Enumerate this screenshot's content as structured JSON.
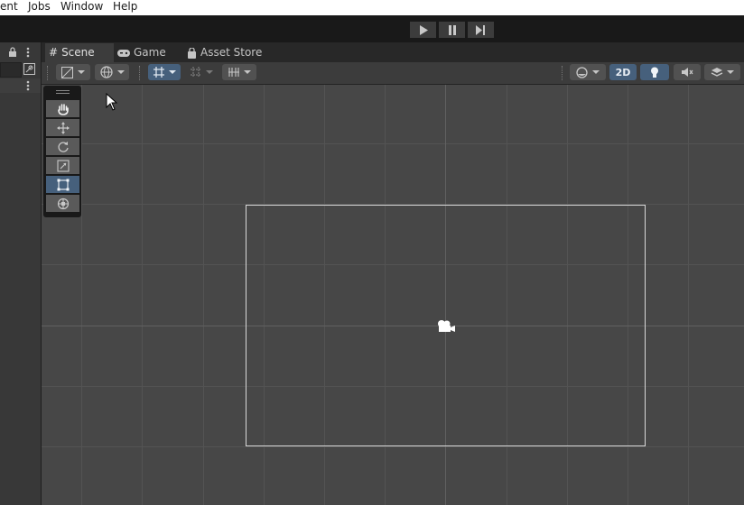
{
  "menu": {
    "item0": "ent",
    "item1": "Jobs",
    "item2": "Window",
    "item3": "Help"
  },
  "tabs": {
    "scene": "Scene",
    "game": "Game",
    "asset_store": "Asset Store"
  },
  "toolbar": {
    "mode_2d": "2D"
  },
  "colors": {
    "accent": "#46607c",
    "scene_bg": "#474747",
    "panel": "#383838"
  },
  "icons": {
    "play": "play-icon",
    "pause": "pause-icon",
    "step": "step-icon",
    "hand": "hand-icon",
    "move": "move-icon",
    "rotate": "rotate-icon",
    "scale": "scale-icon",
    "rect": "rect-transform-icon",
    "transform": "transform-icon",
    "camera": "camera-gizmo-icon"
  }
}
